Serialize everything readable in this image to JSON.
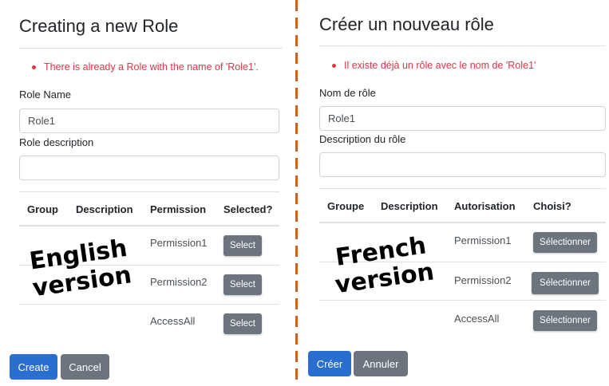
{
  "english": {
    "title": "Creating a new Role",
    "error": "There is already a Role with the name of 'Role1'.",
    "role_name_label": "Role Name",
    "role_name_value": "Role1",
    "role_description_label": "Role description",
    "role_description_value": "",
    "columns": [
      "Group",
      "Description",
      "Permission",
      "Selected?"
    ],
    "rows": [
      {
        "permission": "Permission1",
        "button": "Select"
      },
      {
        "permission": "Permission2",
        "button": "Select"
      },
      {
        "permission": "AccessAll",
        "button": "Select"
      }
    ],
    "create_button": "Create",
    "cancel_button": "Cancel",
    "overlay_line1": "English",
    "overlay_line2": "version"
  },
  "french": {
    "title": "Créer un nouveau rôle",
    "error": "Il existe déjà un rôle avec le nom de 'Role1'",
    "role_name_label": "Nom de rôle",
    "role_name_value": "Role1",
    "role_description_label": "Description du rôle",
    "role_description_value": "",
    "columns": [
      "Groupe",
      "Description",
      "Autorisation",
      "Choisi?"
    ],
    "rows": [
      {
        "permission": "Permission1",
        "button": "Sélectionner"
      },
      {
        "permission": "Permission2",
        "button": "Sélectionner"
      },
      {
        "permission": "AccessAll",
        "button": "Sélectionner"
      }
    ],
    "create_button": "Créer",
    "cancel_button": "Annuler",
    "overlay_line1": "French",
    "overlay_line2": "version"
  },
  "colors": {
    "error": "#dc3545",
    "primary": "#2a6fcf",
    "secondary": "#6c757d",
    "divider": "#c8642a"
  }
}
